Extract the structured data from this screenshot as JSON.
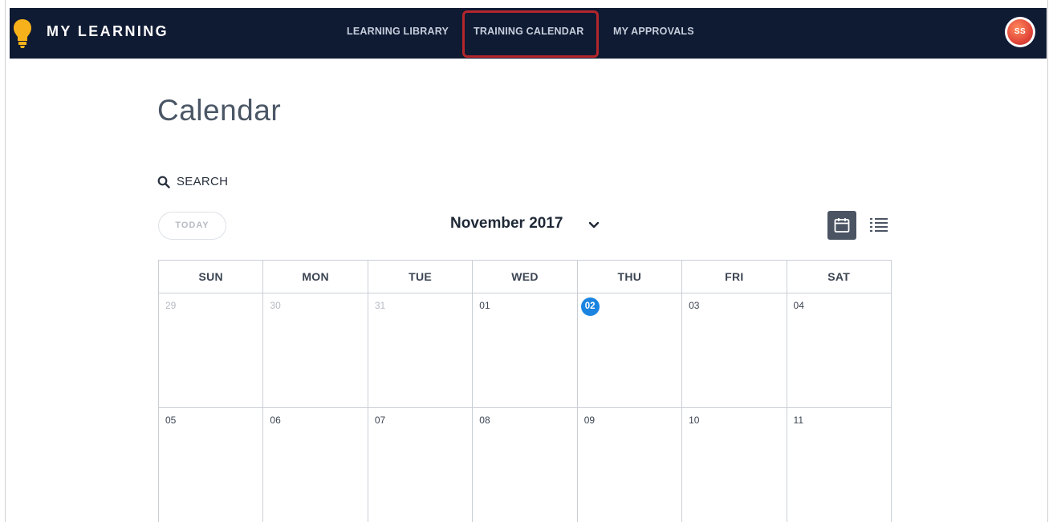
{
  "app": {
    "brand": "MY LEARNING",
    "logo_icon": "lightbulb-icon",
    "accent_color": "#0f1a33",
    "highlight_color": "#b4262c"
  },
  "nav": {
    "items": [
      {
        "label": "LEARNING LIBRARY"
      },
      {
        "label": "TRAINING CALENDAR"
      },
      {
        "label": "MY APPROVALS"
      }
    ],
    "highlighted": "TRAINING CALENDAR"
  },
  "user": {
    "initials": "SS"
  },
  "page": {
    "title": "Calendar"
  },
  "toolbar": {
    "search_label": "SEARCH",
    "today_label": "TODAY",
    "month_label": "November 2017",
    "views": [
      "calendar-view-icon",
      "list-view-icon"
    ],
    "active_view": "calendar-view-icon"
  },
  "calendar": {
    "weekdays": [
      "SUN",
      "MON",
      "TUE",
      "WED",
      "THU",
      "FRI",
      "SAT"
    ],
    "weeks": [
      [
        {
          "day": "29",
          "muted": true
        },
        {
          "day": "30",
          "muted": true
        },
        {
          "day": "31",
          "muted": true
        },
        {
          "day": "01"
        },
        {
          "day": "02",
          "today": true
        },
        {
          "day": "03"
        },
        {
          "day": "04"
        }
      ],
      [
        {
          "day": "05"
        },
        {
          "day": "06"
        },
        {
          "day": "07"
        },
        {
          "day": "08"
        },
        {
          "day": "09"
        },
        {
          "day": "10"
        },
        {
          "day": "11"
        }
      ]
    ],
    "today_color": "#1b84e0"
  }
}
